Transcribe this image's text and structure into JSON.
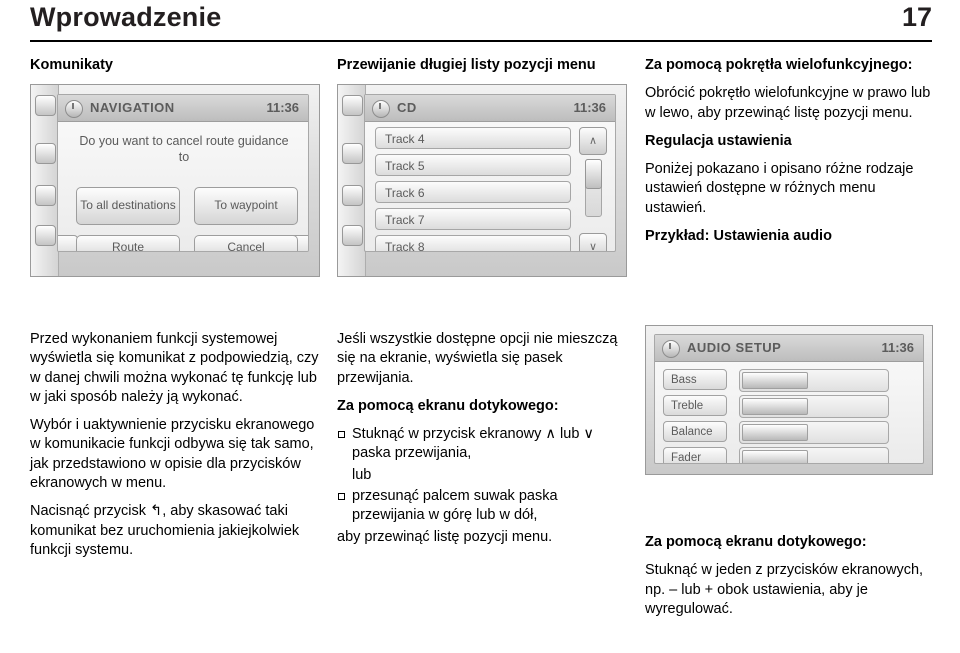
{
  "header": {
    "title": "Wprowadzenie",
    "page_number": "17"
  },
  "column1": {
    "title": "Komunikaty",
    "screen": {
      "name": "navigation-screen",
      "topbar_title": "NAVIGATION",
      "clock": "11:36",
      "message": "Do you want to cancel route guidance to",
      "buttons": [
        "To all destinations",
        "To waypoint",
        "Route",
        "Cancel"
      ]
    },
    "paragraphs": [
      "Przed wykonaniem funkcji systemowej wyświetla się komunikat z podpowiedzią, czy w danej chwili można wykonać tę funkcję lub w jaki sposób należy ją wykonać.",
      "Wybór i uaktywnienie przycisku ekranowego w komunikacie funkcji odbywa się tak samo, jak przedstawiono w opisie dla przycisków ekranowych w menu.",
      "Nacisnąć przycisk ↰, aby skasować taki komunikat bez uruchomienia jakiejkolwiek funkcji systemu."
    ]
  },
  "column2": {
    "title": "Przewijanie długiej listy pozycji menu",
    "screen": {
      "name": "cd-list-screen",
      "topbar_title": "CD",
      "clock": "11:36",
      "rows": [
        "Track 4",
        "Track 5",
        "Track 6",
        "Track 7",
        "Track 8"
      ],
      "scroll_up": "∧",
      "scroll_down": "∨"
    },
    "intro": "Jeśli wszystkie dostępne opcji nie mieszczą się na ekranie, wyświetla się pasek przewijania.",
    "touch_heading": "Za pomocą ekranu dotykowego:",
    "bullets": [
      "Stuknąć w przycisk ekranowy ∧ lub ∨ paska przewijania,",
      "przesunąć palcem suwak paska przewijania w górę lub w dół,"
    ],
    "between_bullets": "lub",
    "closing": "aby przewinąć listę pozycji menu."
  },
  "column3": {
    "knob_heading": "Za pomocą pokrętła wielofunkcyjnego:",
    "knob_text": "Obrócić pokrętło wielofunkcyjne w prawo lub w lewo, aby przewinąć listę pozycji menu.",
    "setting_heading": "Regulacja ustawienia",
    "setting_text": "Poniżej pokazano i opisano różne rodzaje ustawień dostępne w różnych menu ustawień.",
    "example_heading": "Przykład: Ustawienia audio",
    "screen": {
      "name": "audio-setup-screen",
      "topbar_title": "AUDIO SETUP",
      "clock": "11:36",
      "rows": [
        "Bass",
        "Treble",
        "Balance",
        "Fader"
      ]
    },
    "touch_heading": "Za pomocą ekranu dotykowego:",
    "touch_text": "Stuknąć w jeden z przycisków ekranowych, np. – lub + obok ustawienia, aby je wyregulować."
  }
}
